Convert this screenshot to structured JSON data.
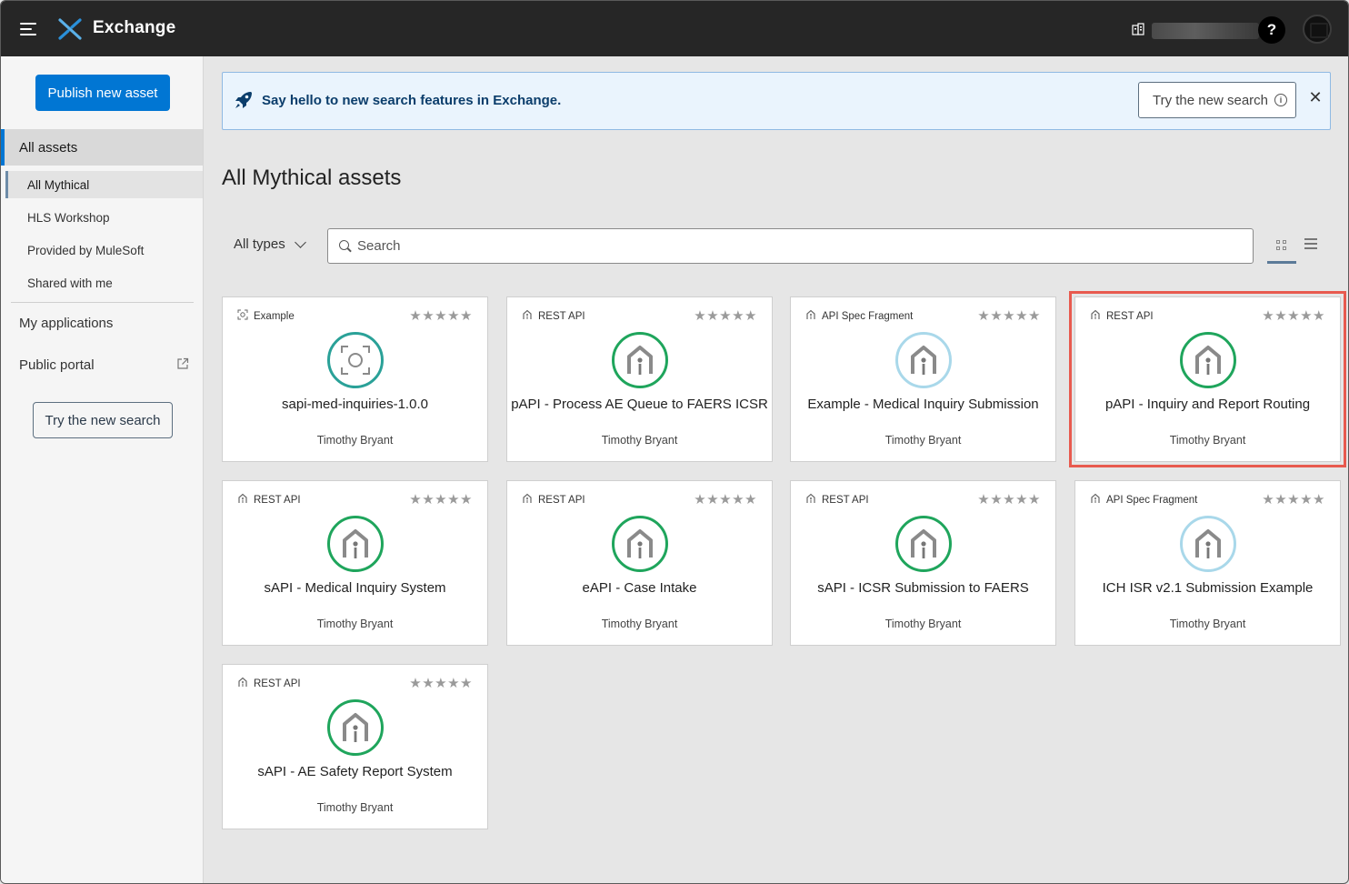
{
  "header": {
    "app_title": "Exchange",
    "help_label": "?"
  },
  "sidebar": {
    "publish_label": "Publish new asset",
    "all_assets": "All assets",
    "sub_items": [
      "All Mythical",
      "HLS Workshop",
      "Provided by MuleSoft",
      "Shared with me"
    ],
    "my_applications": "My applications",
    "public_portal": "Public portal",
    "try_search": "Try the new search"
  },
  "banner": {
    "text": "Say hello to new search features in Exchange.",
    "try_label": "Try the new search",
    "close_label": "✕"
  },
  "main": {
    "title": "All Mythical assets",
    "type_filter": "All types",
    "search_placeholder": "Search"
  },
  "cards": [
    {
      "type": "Example",
      "name": "sapi-med-inquiries-1.0.0",
      "author": "Timothy Bryant",
      "stars": "★★★★★",
      "icon": "example-icon",
      "highlight": false
    },
    {
      "type": "REST API",
      "name": "pAPI - Process AE Queue to FAERS ICSR",
      "author": "Timothy Bryant",
      "stars": "★★★★★",
      "icon": "rest-api-icon",
      "highlight": false
    },
    {
      "type": "API Spec Fragment",
      "name": "Example - Medical Inquiry Submission",
      "author": "Timothy Bryant",
      "stars": "★★★★★",
      "icon": "fragment-icon",
      "highlight": false
    },
    {
      "type": "REST API",
      "name": "pAPI - Inquiry and Report Routing",
      "author": "Timothy Bryant",
      "stars": "★★★★★",
      "icon": "rest-api-icon",
      "highlight": true
    },
    {
      "type": "REST API",
      "name": "sAPI - Medical Inquiry System",
      "author": "Timothy Bryant",
      "stars": "★★★★★",
      "icon": "rest-api-icon",
      "highlight": false
    },
    {
      "type": "REST API",
      "name": "eAPI - Case Intake",
      "author": "Timothy Bryant",
      "stars": "★★★★★",
      "icon": "rest-api-icon",
      "highlight": false
    },
    {
      "type": "REST API",
      "name": "sAPI - ICSR Submission to FAERS",
      "author": "Timothy Bryant",
      "stars": "★★★★★",
      "icon": "rest-api-icon",
      "highlight": false
    },
    {
      "type": "API Spec Fragment",
      "name": "ICH ISR v2.1 Submission Example",
      "author": "Timothy Bryant",
      "stars": "★★★★★",
      "icon": "fragment-icon",
      "highlight": false
    },
    {
      "type": "REST API",
      "name": "sAPI - AE Safety Report System",
      "author": "Timothy Bryant",
      "stars": "★★★★★",
      "icon": "rest-api-icon",
      "highlight": false
    }
  ],
  "colors": {
    "accent": "#0176d3",
    "topbar": "#262626",
    "api_ring": "#1fa55c",
    "fragment_ring": "#a9d8ea",
    "highlight": "#e85a4f"
  }
}
